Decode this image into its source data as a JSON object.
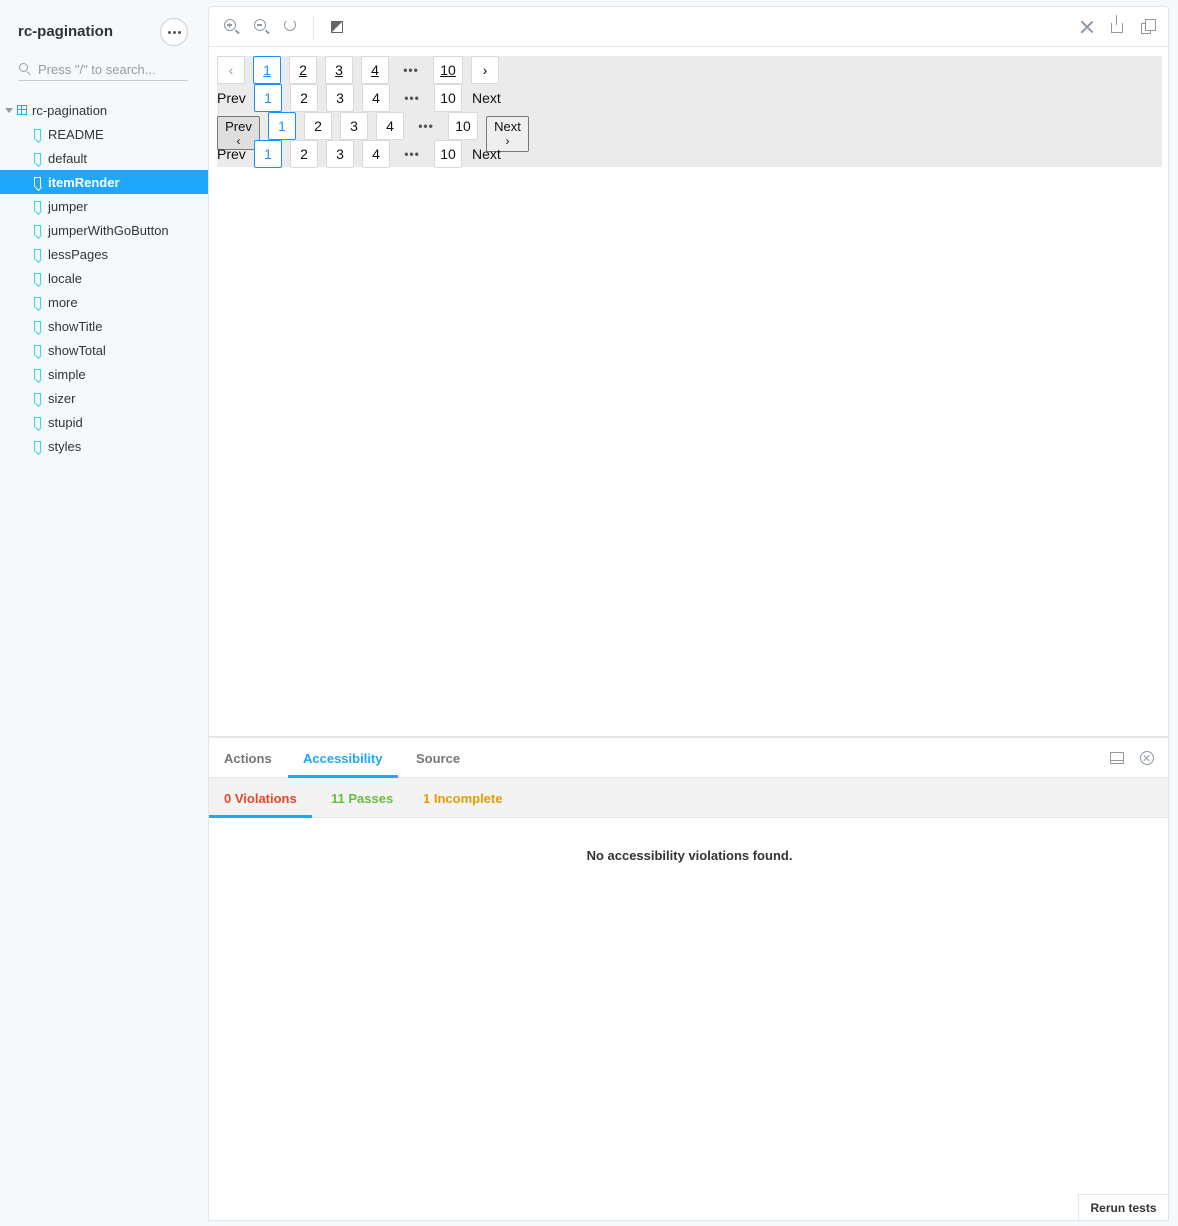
{
  "sidebar": {
    "brand": "rc-pagination",
    "search_placeholder": "Press \"/\" to search...",
    "root": "rc-pagination",
    "items": [
      {
        "label": "README"
      },
      {
        "label": "default"
      },
      {
        "label": "itemRender"
      },
      {
        "label": "jumper"
      },
      {
        "label": "jumperWithGoButton"
      },
      {
        "label": "lessPages"
      },
      {
        "label": "locale"
      },
      {
        "label": "more"
      },
      {
        "label": "showTitle"
      },
      {
        "label": "showTotal"
      },
      {
        "label": "simple"
      },
      {
        "label": "sizer"
      },
      {
        "label": "stupid"
      },
      {
        "label": "styles"
      }
    ],
    "active_item": "itemRender"
  },
  "preview": {
    "row1": {
      "prev": "‹",
      "pages": [
        "1",
        "2",
        "3",
        "4"
      ],
      "ellipsis": "•••",
      "last": "10",
      "next": "›"
    },
    "row2": {
      "prev": "Prev",
      "pages": [
        "1",
        "2",
        "3",
        "4"
      ],
      "ellipsis": "•••",
      "last": "10",
      "next": "Next"
    },
    "row3": {
      "prev": "Prev",
      "prev_arrow": "‹",
      "pages": [
        "1",
        "2",
        "3",
        "4"
      ],
      "ellipsis": "•••",
      "last": "10",
      "next": "Next",
      "next_arrow": "›"
    },
    "row4": {
      "prev": "Prev",
      "pages": [
        "1",
        "2",
        "3",
        "4"
      ],
      "ellipsis": "•••",
      "last": "10",
      "next": "Next"
    }
  },
  "addons": {
    "tabs": [
      "Actions",
      "Accessibility",
      "Source"
    ],
    "active_tab": "Accessibility",
    "subtabs": {
      "violations": "0 Violations",
      "passes": "11 Passes",
      "incomplete": "1 Incomplete"
    },
    "message": "No accessibility violations found.",
    "rerun": "Rerun tests"
  },
  "colors": {
    "accent": "#1ea7fd",
    "violation": "#e6472a",
    "pass": "#66bf3c",
    "incomplete": "#e69d00",
    "active_page": "#1890ff"
  }
}
